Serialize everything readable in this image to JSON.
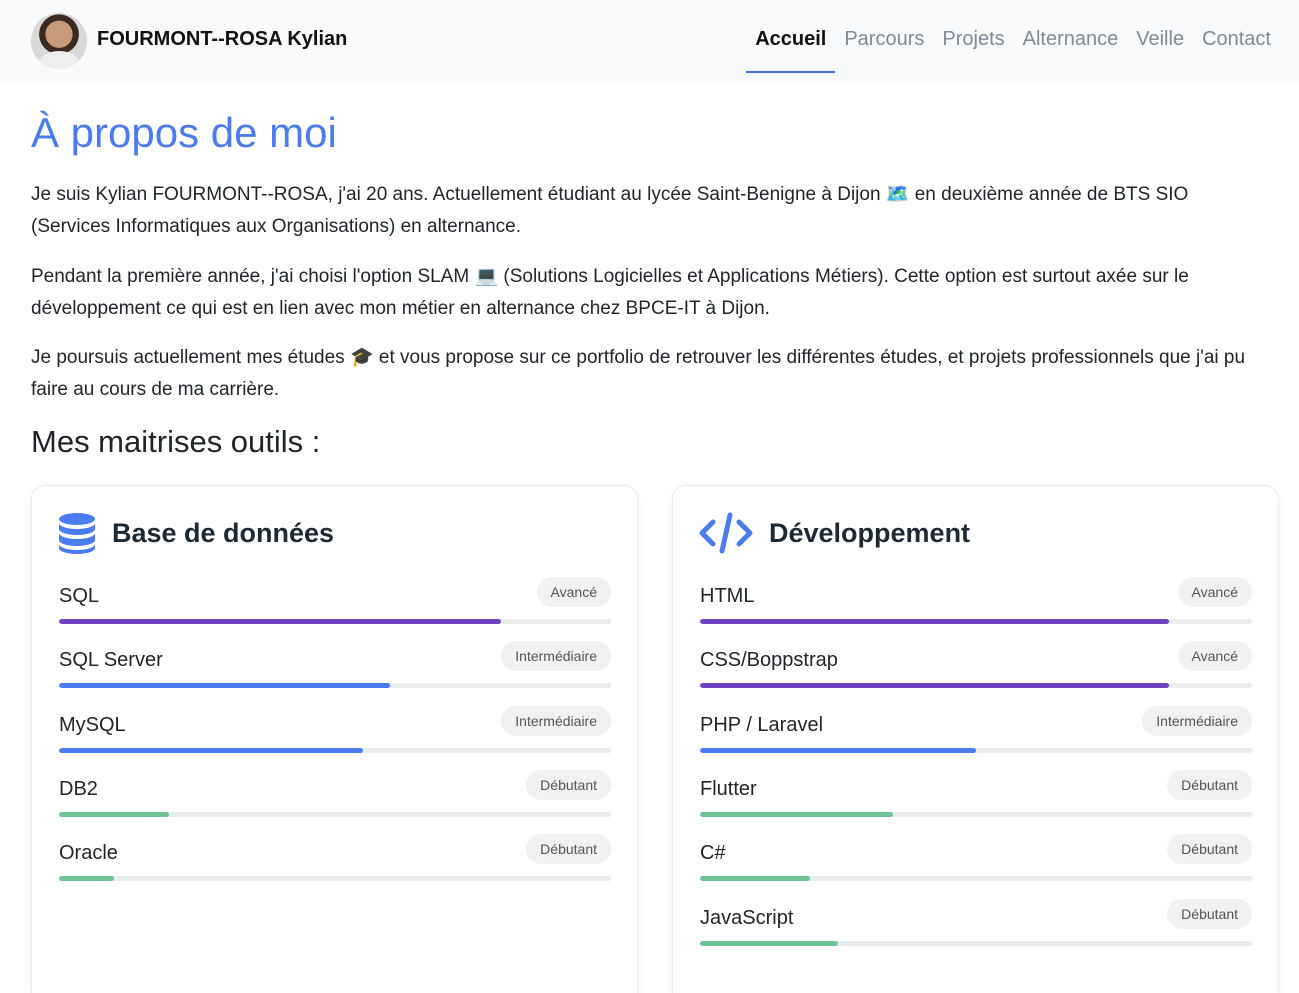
{
  "header": {
    "brand": "FOURMONT--ROSA Kylian",
    "nav": [
      {
        "label": "Accueil",
        "active": true
      },
      {
        "label": "Parcours",
        "active": false
      },
      {
        "label": "Projets",
        "active": false
      },
      {
        "label": "Alternance",
        "active": false
      },
      {
        "label": "Veille",
        "active": false
      },
      {
        "label": "Contact",
        "active": false
      }
    ]
  },
  "about": {
    "title": "À propos de moi",
    "p1": "Je suis Kylian FOURMONT--ROSA, j'ai 20 ans. Actuellement étudiant au lycée Saint-Benigne à Dijon 🗺️ en deuxième année de BTS SIO (Services Informatiques aux Organisations) en alternance.",
    "p2": "Pendant la première année, j'ai choisi l'option SLAM 💻 (Solutions Logicielles et Applications Métiers). Cette option est surtout axée sur le développement ce qui est en lien avec mon métier en alternance chez BPCE-IT à Dijon.",
    "p3": "Je poursuis actuellement mes études 🎓 et vous propose sur ce portfolio de retrouver les différentes études, et projets professionnels que j'ai pu faire au cours de ma carrière."
  },
  "skills_title": "Mes maitrises outils :",
  "levels": {
    "advanced": {
      "label": "Avancé",
      "color": "#6f42c1"
    },
    "intermediate": {
      "label": "Intermédiaire",
      "color": "#4a7cf0"
    },
    "beginner": {
      "label": "Débutant",
      "color": "#6cc396"
    }
  },
  "cards": [
    {
      "title": "Base de données",
      "icon": "database-icon",
      "skills": [
        {
          "name": "SQL",
          "level": "Avancé",
          "percent": 80
        },
        {
          "name": "SQL Server",
          "level": "Intermédiaire",
          "percent": 60
        },
        {
          "name": "MySQL",
          "level": "Intermédiaire",
          "percent": 55
        },
        {
          "name": "DB2",
          "level": "Débutant",
          "percent": 20
        },
        {
          "name": "Oracle",
          "level": "Débutant",
          "percent": 10
        }
      ]
    },
    {
      "title": "Développement",
      "icon": "code-icon",
      "skills": [
        {
          "name": "HTML",
          "level": "Avancé",
          "percent": 85
        },
        {
          "name": "CSS/Boppstrap",
          "level": "Avancé",
          "percent": 85
        },
        {
          "name": "PHP / Laravel",
          "level": "Intermédiaire",
          "percent": 50
        },
        {
          "name": "Flutter",
          "level": "Débutant",
          "percent": 35
        },
        {
          "name": "C#",
          "level": "Débutant",
          "percent": 20
        },
        {
          "name": "JavaScript",
          "level": "Débutant",
          "percent": 25
        }
      ]
    }
  ]
}
